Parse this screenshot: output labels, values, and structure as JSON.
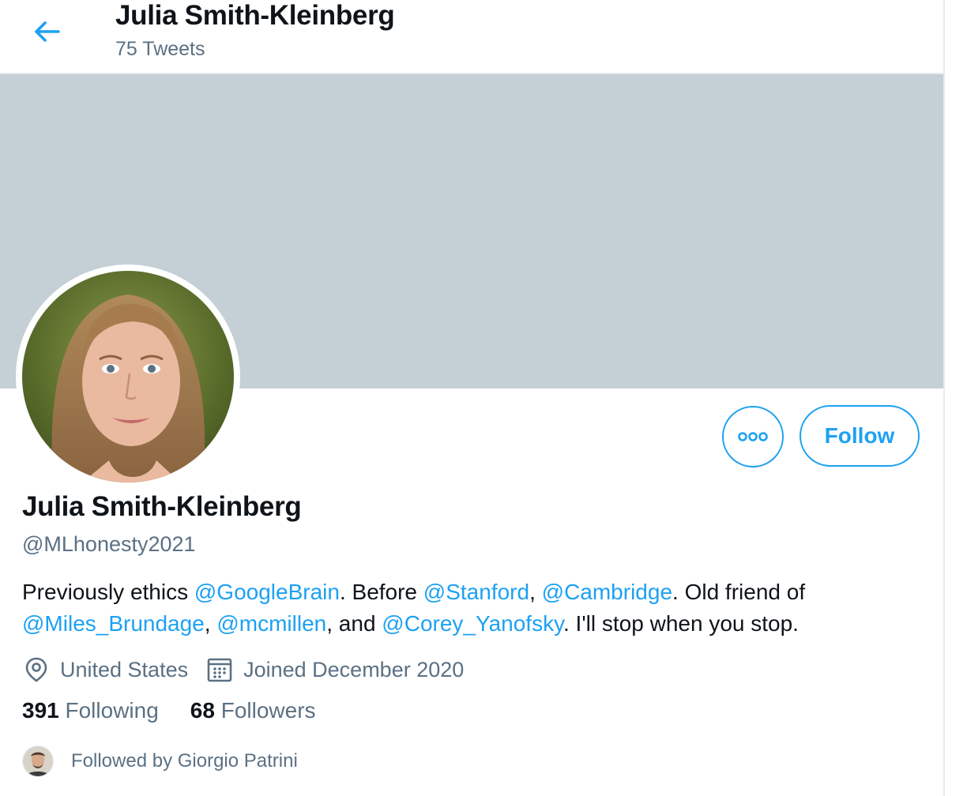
{
  "header": {
    "title": "Julia Smith-Kleinberg",
    "tweet_count": "75 Tweets",
    "back_icon": "arrow-left-icon"
  },
  "profile": {
    "name": "Julia Smith-Kleinberg",
    "handle": "@MLhonesty2021",
    "more_icon": "more-options-icon",
    "follow_label": "Follow",
    "bio": {
      "t1": "Previously ethics ",
      "m1": "@GoogleBrain",
      "t2": ". Before ",
      "m2": "@Stanford",
      "t3": ", ",
      "m3": "@Cambridge",
      "t4": ". Old friend of ",
      "m4": "@Miles_Brundage",
      "t5": ", ",
      "m5": "@mcmillen",
      "t6": ", and ",
      "m6": "@Corey_Yanofsky",
      "t7": ". I'll stop when you stop."
    },
    "location": "United States",
    "joined": "Joined December 2020",
    "following_count": "391",
    "following_label": "Following",
    "followers_count": "68",
    "followers_label": "Followers",
    "followed_by": "Followed by Giorgio Patrini"
  },
  "colors": {
    "accent": "#1da1f2",
    "banner": "#c4cfd6",
    "secondary_text": "#5b7083",
    "primary_text": "#0f1419"
  }
}
